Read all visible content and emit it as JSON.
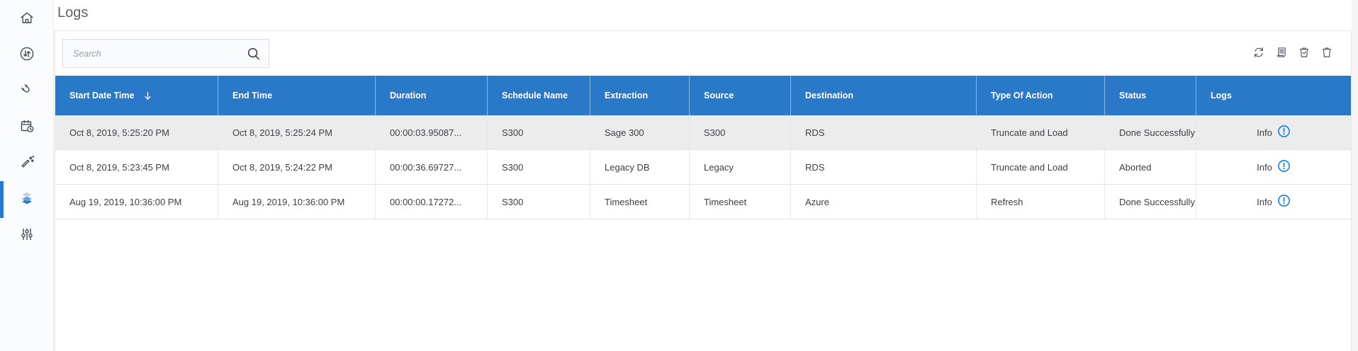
{
  "page": {
    "title": "Logs"
  },
  "colors": {
    "header_blue": "#2a79c8",
    "info_blue": "#1e88e5",
    "selected_row_gray": "#ececec",
    "sidebar_icon": "#454c5c"
  },
  "sidebar": {
    "items": [
      {
        "icon": "home-icon",
        "active": false
      },
      {
        "icon": "sync-circle-icon",
        "active": false
      },
      {
        "icon": "magnet-icon",
        "active": false
      },
      {
        "icon": "calendar-clock-icon",
        "active": false
      },
      {
        "icon": "magic-wand-icon",
        "active": false
      },
      {
        "icon": "layers-icon",
        "active": true
      },
      {
        "icon": "sliders-icon",
        "active": false
      }
    ]
  },
  "search": {
    "placeholder": "Search",
    "value": ""
  },
  "toolbar": {
    "icons": [
      "refresh-icon",
      "report-icon",
      "trash-check-icon",
      "trash-icon"
    ]
  },
  "table": {
    "columns": [
      "Start Date Time",
      "End Time",
      "Duration",
      "Schedule Name",
      "Extraction",
      "Source",
      "Destination",
      "Type Of Action",
      "Status",
      "Logs"
    ],
    "sort": {
      "column": "Start Date Time",
      "direction": "descending"
    },
    "rows": [
      {
        "start_date_time": "Oct 8, 2019, 5:25:20 PM",
        "end_time": "Oct 8, 2019, 5:25:24 PM",
        "duration": "00:00:03.95087...",
        "schedule_name": "S300",
        "extraction": "Sage 300",
        "source": "S300",
        "destination": "RDS",
        "type_of_action": "Truncate and Load",
        "status": "Done Successfully",
        "logs_label": "Info",
        "highlighted": true
      },
      {
        "start_date_time": "Oct 8, 2019, 5:23:45 PM",
        "end_time": "Oct 8, 2019, 5:24:22 PM",
        "duration": "00:00:36.69727...",
        "schedule_name": "S300",
        "extraction": "Legacy DB",
        "source": "Legacy",
        "destination": "RDS",
        "type_of_action": "Truncate and Load",
        "status": "Aborted",
        "logs_label": "Info",
        "highlighted": false
      },
      {
        "start_date_time": "Aug 19, 2019, 10:36:00 PM",
        "end_time": "Aug 19, 2019, 10:36:00 PM",
        "duration": "00:00:00.17272...",
        "schedule_name": "S300",
        "extraction": "Timesheet",
        "source": "Timesheet",
        "destination": "Azure",
        "type_of_action": "Refresh",
        "status": "Done Successfully",
        "logs_label": "Info",
        "highlighted": false
      }
    ]
  }
}
